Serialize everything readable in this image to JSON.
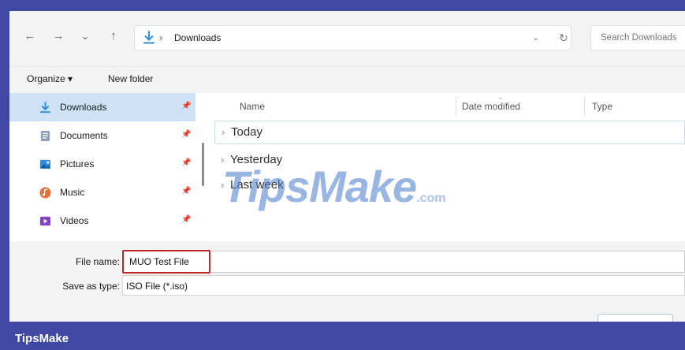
{
  "nav": {
    "back_icon": "arrow-left",
    "forward_icon": "arrow-right",
    "recent_icon": "chevron-down",
    "up_icon": "arrow-up",
    "back": "←",
    "forward": "→",
    "recent": "⌄",
    "up": "↑"
  },
  "address": {
    "separator": "›",
    "location": "Downloads",
    "dropdown": "⌄",
    "refresh": "↻"
  },
  "search": {
    "placeholder": "Search Downloads"
  },
  "command_bar": {
    "organize": "Organize ▾",
    "new_folder": "New folder"
  },
  "sidebar": {
    "items": [
      {
        "label": "Downloads",
        "icon": "download-icon",
        "selected": true,
        "pin": "📌"
      },
      {
        "label": "Documents",
        "icon": "document-icon",
        "selected": false,
        "pin": "📌"
      },
      {
        "label": "Pictures",
        "icon": "pictures-icon",
        "selected": false,
        "pin": "📌"
      },
      {
        "label": "Music",
        "icon": "music-icon",
        "selected": false,
        "pin": "📌"
      },
      {
        "label": "Videos",
        "icon": "videos-icon",
        "selected": false,
        "pin": "📌"
      }
    ]
  },
  "columns": {
    "name": "Name",
    "date_modified": "Date modified",
    "type": "Type",
    "sort_indicator": "⌄"
  },
  "groups": [
    {
      "label": "Today",
      "chevron": "›"
    },
    {
      "label": "Yesterday",
      "chevron": "›"
    },
    {
      "label": "Last week",
      "chevron": "›"
    }
  ],
  "form": {
    "file_name_label": "File name:",
    "file_name_value": "MUO Test File",
    "save_as_type_label": "Save as type:",
    "save_as_type_value": "ISO File (*.iso)"
  },
  "watermark": {
    "text": "TipsMake",
    "suffix": ".com"
  },
  "brand": {
    "name": "TipsMake"
  },
  "colors": {
    "frame": "#3f49a3",
    "selected_bg": "#cde2f6",
    "highlight_border": "#c0262c",
    "download_icon": "#2a8fd4"
  }
}
